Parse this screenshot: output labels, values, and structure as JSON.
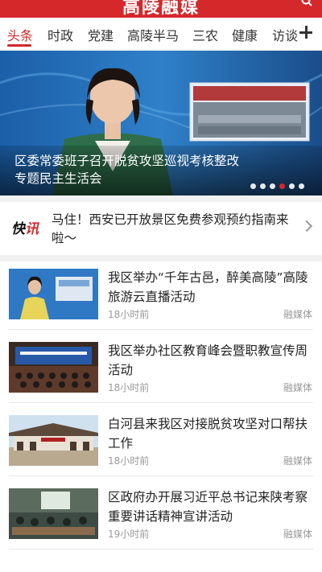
{
  "app": {
    "title": "高陵融媒"
  },
  "tabs": [
    "头条",
    "时政",
    "党建",
    "高陵半马",
    "三农",
    "健康",
    "访谈"
  ],
  "banner": {
    "title": "区委常委班子召开脱贫攻坚巡视考核整改专题民主生活会",
    "total_slides": 6,
    "active_slide": 4
  },
  "flash": {
    "logo_a": "快",
    "logo_b": "讯",
    "text": "马住！西安已开放景区免费参观预约指南来啦～"
  },
  "news": [
    {
      "title": "我区举办“千年古邑，醉美高陵”高陵旅游云直播活动",
      "time": "18小时前",
      "source": "融媒体"
    },
    {
      "title": "我区举办社区教育峰会暨职教宣传周活动",
      "time": "18小时前",
      "source": "融媒体"
    },
    {
      "title": "白河县来我区对接脱贫攻坚对口帮扶工作",
      "time": "18小时前",
      "source": "融媒体"
    },
    {
      "title": "区政府办开展习近平总书记来陕考察重要讲话精神宣讲活动",
      "time": "19小时前",
      "source": "融媒体"
    }
  ],
  "colors": {
    "brand": "#d4282a"
  }
}
